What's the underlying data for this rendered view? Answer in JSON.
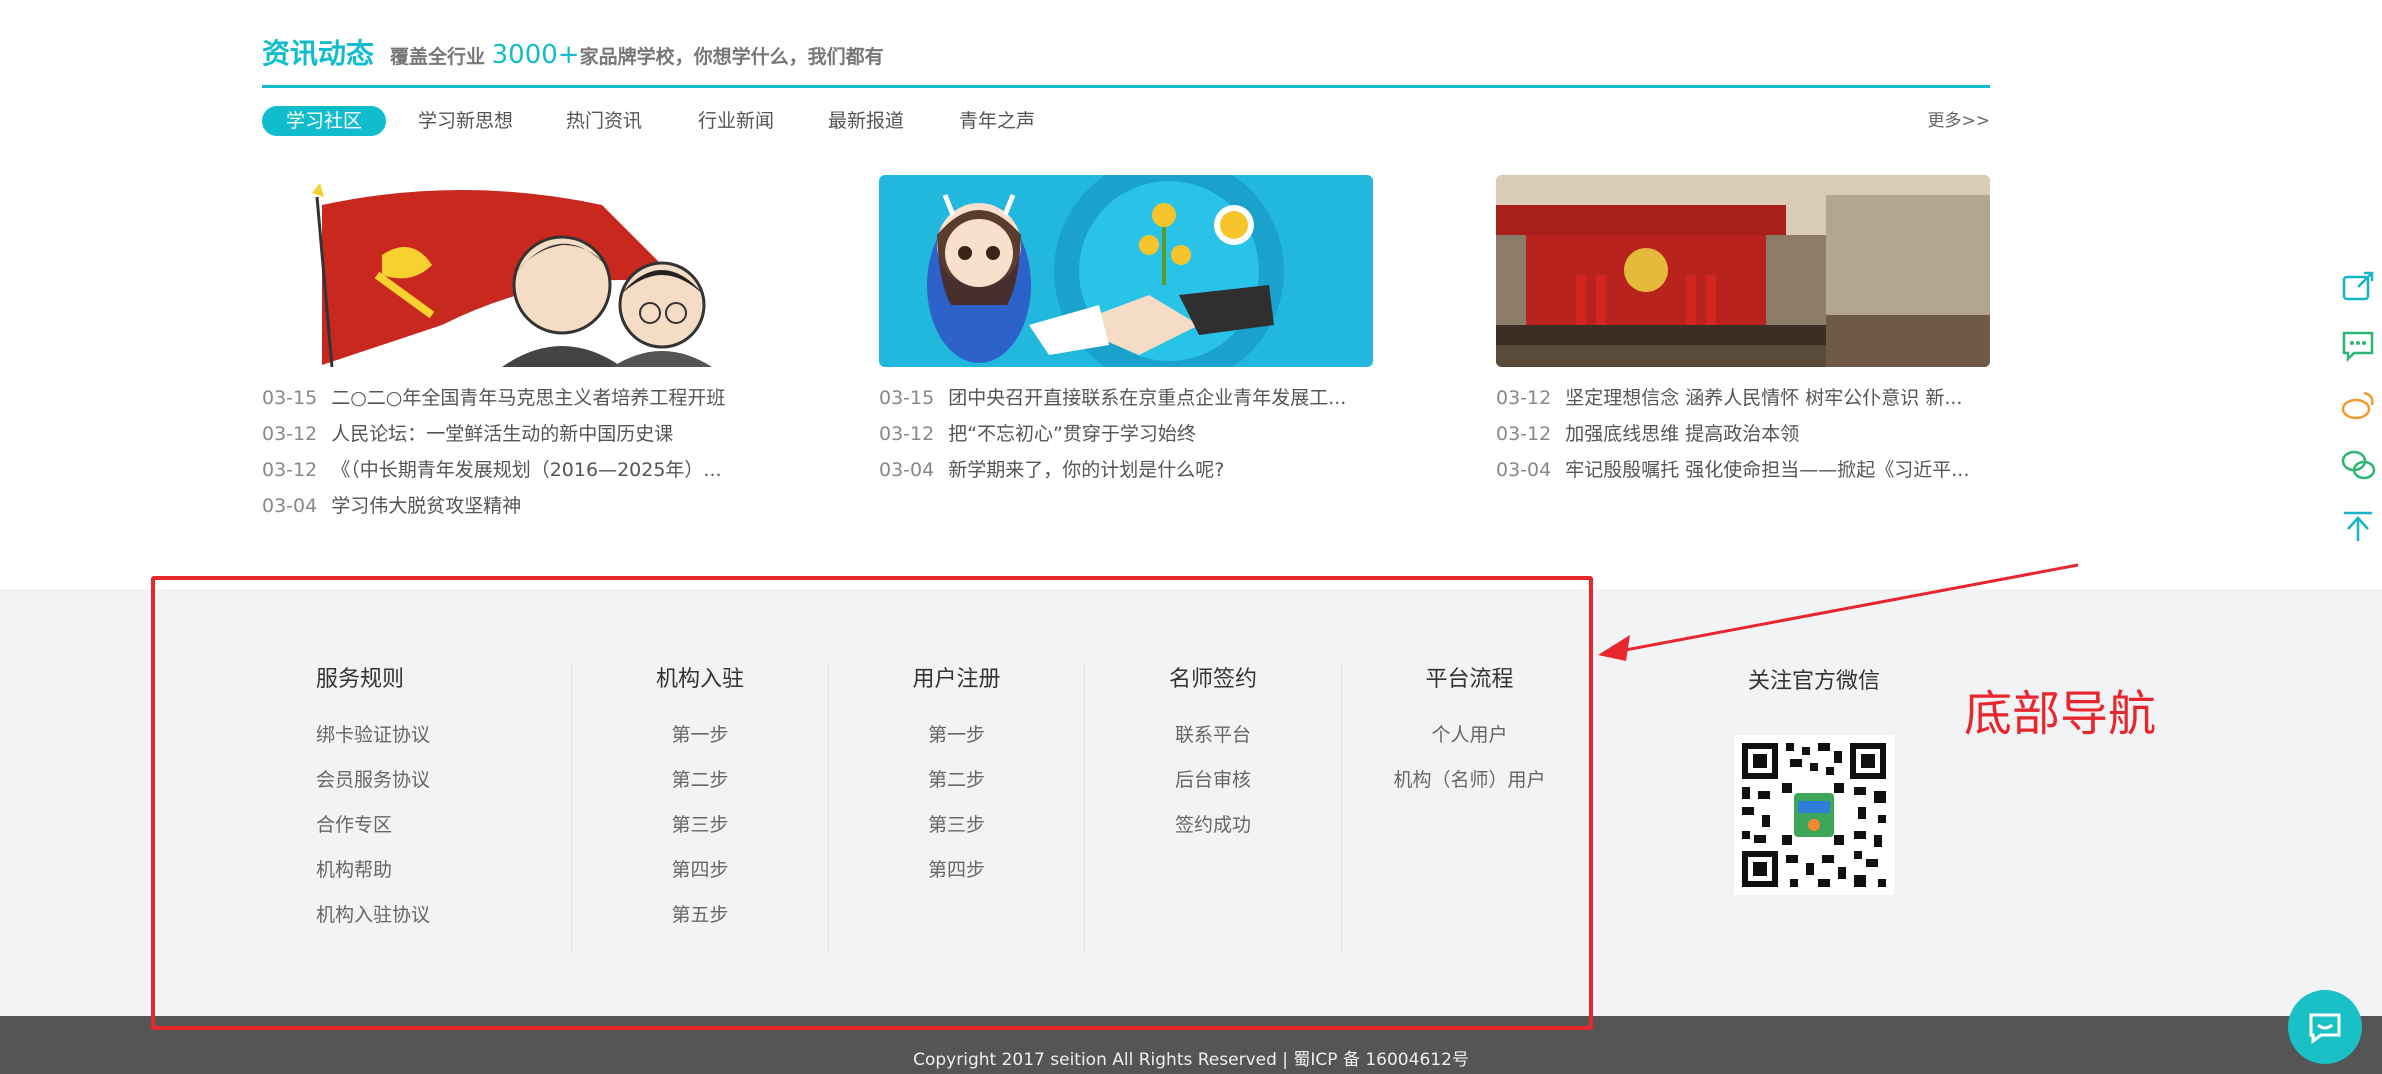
{
  "news": {
    "title": "资讯动态",
    "subtitle_pre": "覆盖全行业",
    "subtitle_num": "3000+",
    "subtitle_post": "家品牌学校，你想学什么，我们都有",
    "tabs": [
      "学习社区",
      "学习新思想",
      "热门资讯",
      "行业新闻",
      "最新报道",
      "青年之声"
    ],
    "more": "更多>>",
    "columns": [
      {
        "image": "party-flag-cartoon",
        "items": [
          {
            "date": "03-15",
            "title": "二○二○年全国青年马克思主义者培养工程开班"
          },
          {
            "date": "03-12",
            "title": "人民论坛：一堂鲜活生动的新中国历史课"
          },
          {
            "date": "03-12",
            "title": "《（中长期青年发展规划（2016—2025年）..."
          },
          {
            "date": "03-04",
            "title": "学习伟大脱贫攻坚精神"
          }
        ]
      },
      {
        "image": "handshake-cartoon",
        "items": [
          {
            "date": "03-15",
            "title": "团中央召开直接联系在京重点企业青年发展工..."
          },
          {
            "date": "03-12",
            "title": "把“不忘初心”贯穿于学习始终"
          },
          {
            "date": "03-04",
            "title": "新学期来了，你的计划是什么呢?"
          }
        ]
      },
      {
        "image": "conference-hall-photo",
        "items": [
          {
            "date": "03-12",
            "title": "坚定理想信念 涵养人民情怀 树牢公仆意识 新..."
          },
          {
            "date": "03-12",
            "title": "加强底线思维 提高政治本领"
          },
          {
            "date": "03-04",
            "title": "牢记殷殷嘱托 强化使命担当——掀起《习近平..."
          }
        ]
      }
    ]
  },
  "footer": {
    "columns": [
      {
        "title": "服务规则",
        "links": [
          "绑卡验证协议",
          "会员服务协议",
          "合作专区",
          "机构帮助",
          "机构入驻协议"
        ]
      },
      {
        "title": "机构入驻",
        "links": [
          "第一步",
          "第二步",
          "第三步",
          "第四步",
          "第五步"
        ]
      },
      {
        "title": "用户注册",
        "links": [
          "第一步",
          "第二步",
          "第三步",
          "第四步"
        ]
      },
      {
        "title": "名师签约",
        "links": [
          "联系平台",
          "后台审核",
          "签约成功"
        ]
      },
      {
        "title": "平台流程",
        "links": [
          "个人用户",
          "机构（名师）用户"
        ]
      }
    ],
    "qr_title": "关注官方微信",
    "copyright": "Copyright 2017 seition All Rights Reserved | 蜀ICP 备 16004612号"
  },
  "annotation": {
    "label": "底部导航",
    "color": "#e8262d"
  },
  "sidebar": {
    "icons": [
      "share-icon",
      "message-icon",
      "weibo-icon",
      "wechat-icon",
      "back-to-top-icon"
    ]
  },
  "colors": {
    "accent": "#11bccd",
    "footer_bg": "#f2f3f5",
    "copyright_bg": "#555555"
  }
}
